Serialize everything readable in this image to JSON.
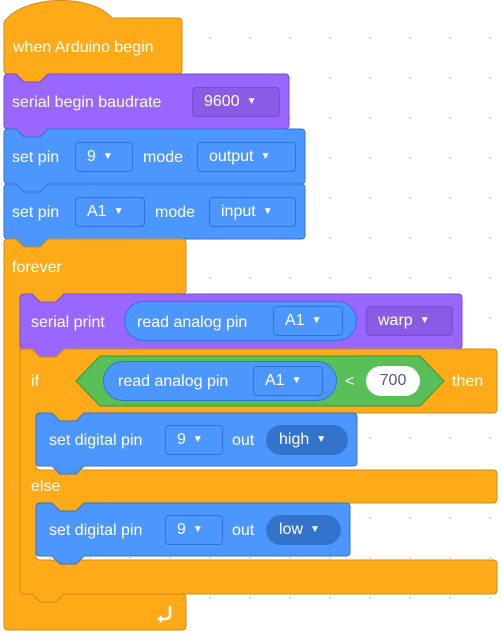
{
  "hat": {
    "label": "when Arduino begin"
  },
  "serial_begin": {
    "label": "serial begin baudrate",
    "baud": "9600"
  },
  "set_pin_1": {
    "label": "set pin",
    "pin": "9",
    "mode_label": "mode",
    "mode": "output"
  },
  "set_pin_2": {
    "label": "set pin",
    "pin": "A1",
    "mode_label": "mode",
    "mode": "input"
  },
  "forever": {
    "label": "forever"
  },
  "serial_print": {
    "label": "serial print",
    "reporter_label": "read analog pin",
    "reporter_pin": "A1",
    "format": "warp"
  },
  "if_else": {
    "if_label": "if",
    "then_label": "then",
    "else_label": "else",
    "condition": {
      "reporter_label": "read analog pin",
      "reporter_pin": "A1",
      "operator": "<",
      "value": "700"
    }
  },
  "digital_high": {
    "label": "set digital pin",
    "pin": "9",
    "out_label": "out",
    "level": "high"
  },
  "digital_low": {
    "label": "set digital pin",
    "pin": "9",
    "out_label": "out",
    "level": "low"
  },
  "icons": {
    "dropdown": "caret-down-icon",
    "loop": "loop-arrow-icon"
  },
  "colors": {
    "events": "#FFAB19",
    "events_dark": "#CF8B17",
    "control": "#FFAB19",
    "serial": "#9966FF",
    "serial_dark": "#774DCB",
    "pins": "#4C97FF",
    "pins_dark": "#3373CC",
    "operators": "#59C059",
    "operators_dark": "#389438"
  }
}
